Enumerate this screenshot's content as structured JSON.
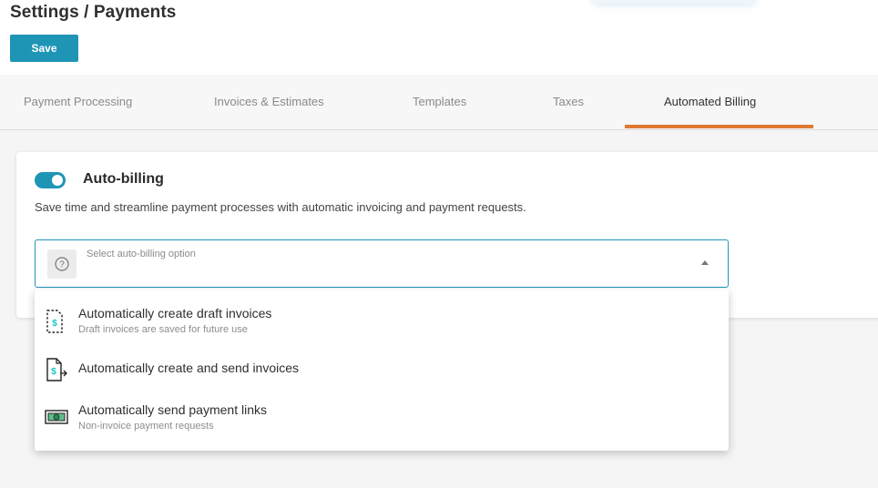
{
  "header": {
    "title": "Settings / Payments",
    "save_label": "Save"
  },
  "tabs": [
    {
      "label": "Payment Processing",
      "active": false
    },
    {
      "label": "Invoices & Estimates",
      "active": false
    },
    {
      "label": "Templates",
      "active": false
    },
    {
      "label": "Taxes",
      "active": false
    },
    {
      "label": "Automated Billing",
      "active": true
    }
  ],
  "auto_billing": {
    "toggle_on": true,
    "title": "Auto-billing",
    "description": "Save time and streamline payment processes with automatic invoicing and payment requests.",
    "select": {
      "placeholder": "Select auto-billing option",
      "icon": "question-icon"
    },
    "options": [
      {
        "title": "Automatically create draft invoices",
        "subtitle": "Draft invoices are saved for future use",
        "icon": "draft-invoice-icon"
      },
      {
        "title": "Automatically create and send invoices",
        "subtitle": "",
        "icon": "send-invoice-icon"
      },
      {
        "title": "Automatically send payment links",
        "subtitle": "Non-invoice payment requests",
        "icon": "money-bill-icon"
      }
    ]
  },
  "colors": {
    "accent": "#1f95b6",
    "tab_underline": "#e07a33",
    "icon_teal": "#18c3c3"
  }
}
